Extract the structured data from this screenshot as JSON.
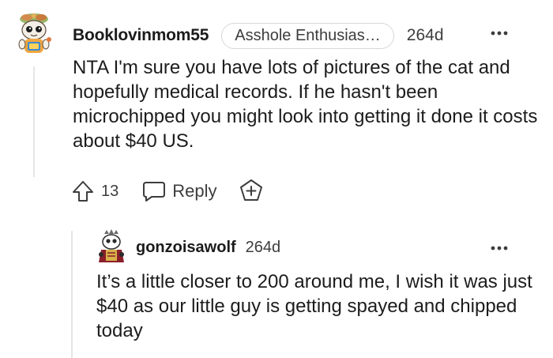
{
  "comment": {
    "username": "Booklovinmom55",
    "flair": "Asshole Enthusias…",
    "age": "264d",
    "more_icon": "ellipsis-icon",
    "body": "NTA I'm sure you have lots of pictures of the cat and hopefully medical records. If he hasn't been microchipped you might look into getting it done it costs about $40 US.",
    "score": "13",
    "reply_label": "Reply",
    "icons": {
      "upvote": "upvote-arrow-icon",
      "reply": "speech-bubble-icon",
      "award": "award-plus-icon"
    }
  },
  "reply": {
    "username": "gonzoisawolf",
    "age": "264d",
    "more_icon": "ellipsis-icon",
    "body": "It’s a little closer to 200 around me, I wish it was just $40 as our little guy is getting spayed and chipped today"
  },
  "colors": {
    "text": "#1c1c1c",
    "meta": "#3d3d3d",
    "thread_line": "#e6e6e6",
    "flair_border": "#d7d7d7"
  }
}
